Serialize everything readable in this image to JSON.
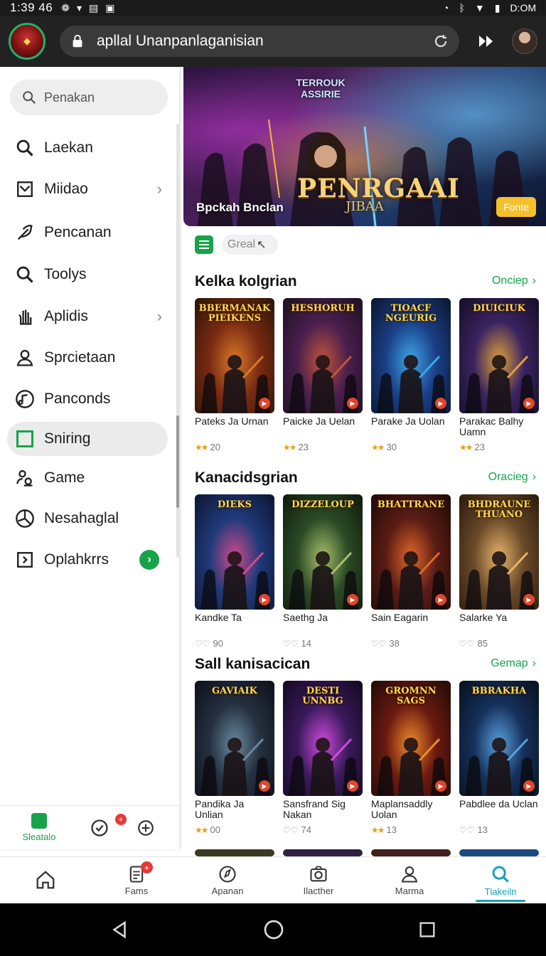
{
  "status": {
    "time": "1:39 46",
    "battery": "D:OM"
  },
  "browser": {
    "url": "apllal Unanpanlaganisian"
  },
  "sidebar": {
    "search_placeholder": "Penakan",
    "items": [
      {
        "label": "Laekan",
        "icon": "search-icon",
        "has_chevron": false
      },
      {
        "label": "Miidao",
        "icon": "inbox-icon",
        "has_chevron": true
      },
      {
        "label": "Pencanan",
        "icon": "feather-icon",
        "has_chevron": false
      },
      {
        "label": "Toolys",
        "icon": "search-icon",
        "has_chevron": false
      },
      {
        "label": "Aplidis",
        "icon": "hand-icon",
        "has_chevron": true
      },
      {
        "label": "Sprcietaan",
        "icon": "person-icon",
        "has_chevron": false
      },
      {
        "label": "Panconds",
        "icon": "music-icon",
        "has_chevron": false
      },
      {
        "label": "Sniring",
        "icon": "square-icon",
        "has_chevron": false,
        "active": true
      },
      {
        "label": "Game",
        "icon": "people-icon",
        "has_chevron": false
      },
      {
        "label": "Nesahaglal",
        "icon": "pie-icon",
        "has_chevron": false
      },
      {
        "label": "Oplahkrrs",
        "icon": "export-icon",
        "has_go": true
      }
    ],
    "bottom": {
      "tab1_label": "Sleatalo",
      "badge": "+"
    }
  },
  "hero": {
    "logo_text": "TERROUK ASSIRIE",
    "title": "PENRGAAI",
    "subtitle": "JIBAA",
    "caption": "Bpckah Bnclan",
    "button": "Fonte"
  },
  "chip": {
    "label": "Greal"
  },
  "sections": [
    {
      "title": "Kelka kolgrian",
      "more": "Onciep",
      "cards": [
        {
          "cover_title": "BBERMANAK PIEIKENS",
          "name": "Pateks Ja Urnan",
          "rating_icon": "star",
          "count": "20",
          "colors": [
            "#7a2a12",
            "#d87a28",
            "#2a1508"
          ]
        },
        {
          "cover_title": "HESHORUH",
          "name": "Paicke Ja Uelan",
          "rating_icon": "star",
          "count": "23",
          "colors": [
            "#4a1f4e",
            "#c2543a",
            "#1c1020"
          ]
        },
        {
          "cover_title": "TIOACF NGEURIG",
          "name": "Parake Ja Uolan",
          "rating_icon": "star",
          "count": "30",
          "colors": [
            "#1a3f86",
            "#3fa6e8",
            "#0b1530"
          ]
        },
        {
          "cover_title": "DIUICIUK",
          "name": "Parakac Balhy Uamn",
          "rating_icon": "star",
          "count": "23",
          "colors": [
            "#3a2360",
            "#e0a23a",
            "#150e25"
          ]
        }
      ]
    },
    {
      "title": "Kanacidsgrian",
      "more": "Oraciеg",
      "cards": [
        {
          "cover_title": "DIEKS",
          "name": "Kandke Ta",
          "rating_icon": "like",
          "count": "90",
          "colors": [
            "#1f3a7a",
            "#d24a8a",
            "#0d1430"
          ]
        },
        {
          "cover_title": "DIZZELOUP",
          "name": "Saethg Ja",
          "rating_icon": "like",
          "count": "14",
          "colors": [
            "#2b4a26",
            "#a7c06a",
            "#0f1a0c"
          ]
        },
        {
          "cover_title": "BHATTRANE",
          "name": "Sain Eagarin",
          "rating_icon": "like",
          "count": "38",
          "colors": [
            "#5a1c14",
            "#e2682a",
            "#1d0a06"
          ]
        },
        {
          "cover_title": "BHDRAUNE THUANO",
          "name": "Salarke Ya",
          "rating_icon": "like",
          "count": "85",
          "colors": [
            "#6a4a2a",
            "#e8b46a",
            "#2a1a0c"
          ]
        }
      ]
    },
    {
      "title": "Sall kanisacican",
      "more": "Gemap",
      "cards": [
        {
          "cover_title": "GAVIAIK",
          "name": "Pandika Ja Unlian",
          "rating_icon": "star",
          "count": "00",
          "colors": [
            "#253040",
            "#6a8aa0",
            "#0c1018"
          ]
        },
        {
          "cover_title": "DESTI UNNBG",
          "name": "Sansfrand Sig Nakan",
          "rating_icon": "like",
          "count": "74",
          "colors": [
            "#3a1a5a",
            "#d04ae0",
            "#120820"
          ]
        },
        {
          "cover_title": "GROMNN SAGS",
          "name": "Maplansaddly Uolan",
          "rating_icon": "star",
          "count": "13",
          "colors": [
            "#6a1a10",
            "#f08a2a",
            "#200a06"
          ]
        },
        {
          "cover_title": "BBRAKHA",
          "name": "Pabdlee da Uclan",
          "rating_icon": "like",
          "count": "13",
          "colors": [
            "#15305a",
            "#58a0e0",
            "#08101e"
          ]
        }
      ]
    }
  ],
  "bottom_nav": [
    {
      "label": "",
      "icon": "home-icon"
    },
    {
      "label": "Fams",
      "icon": "document-icon",
      "badge": "+"
    },
    {
      "label": "Apanan",
      "icon": "compass-icon"
    },
    {
      "label": "Ilacther",
      "icon": "camera-icon"
    },
    {
      "label": "Marma",
      "icon": "person-icon"
    },
    {
      "label": "Tlakeiln",
      "icon": "search-icon",
      "active": true
    }
  ],
  "colors": {
    "accent": "#18a34a",
    "active_nav": "#15a3b8",
    "rating_star": "#e0a21a"
  }
}
